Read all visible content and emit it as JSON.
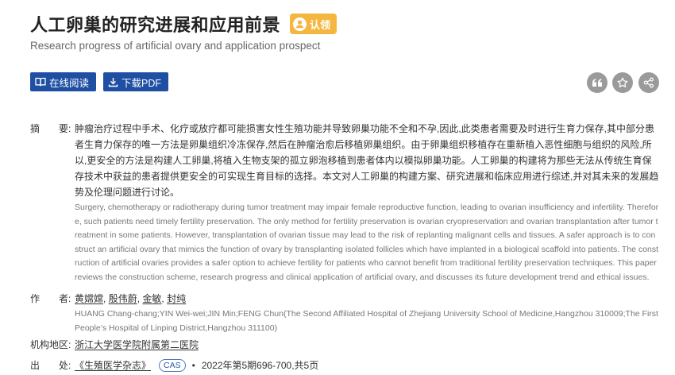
{
  "title": "人工卵巢的研究进展和应用前景",
  "claim_label": "认领",
  "subtitle": "Research progress of artificial ovary and application prospect",
  "buttons": {
    "read_online": "在线阅读",
    "download_pdf": "下载PDF"
  },
  "icons": {
    "cite": "quote-icon",
    "favorite": "star-icon",
    "share": "share-icon"
  },
  "abstract": {
    "label": "摘　　要:",
    "zh": "肿瘤治疗过程中手术、化疗或放疗都可能损害女性生殖功能并导致卵巢功能不全和不孕,因此,此类患者需要及时进行生育力保存,其中部分患者生育力保存的唯一方法是卵巢组织冷冻保存,然后在肿瘤治愈后移植卵巢组织。由于卵巢组织移植存在重新植入恶性细胞与组织的风险,所以,更安全的方法是构建人工卵巢,将植入生物支架的孤立卵泡移植到患者体内以模拟卵巢功能。人工卵巢的构建将为那些无法从传统生育保存技术中获益的患者提供更安全的可实现生育目标的选择。本文对人工卵巢的构建方案、研究进展和临床应用进行综述,并对其未来的发展趋势及伦理问题进行讨论。",
    "en": "Surgery, chemotherapy or radiotherapy during tumor treatment may impair female reproductive function, leading to ovarian insufficiency and infertility. Therefore, such patients need timely fertility preservation. The only method for fertility preservation is ovarian cryopreservation and ovarian transplantation after tumor treatment in some patients. However, transplantation of ovarian tissue may lead to the risk of replanting malignant cells and tissues. A safer approach is to construct an artificial ovary that mimics the function of ovary by transplanting isolated follicles which have implanted in a biological scaffold into patients. The construction of artificial ovaries provides a safer option to achieve fertility for patients who cannot benefit from traditional fertility preservation techniques. This paper reviews the construction scheme, research progress and clinical application of artificial ovary, and discusses its future development trend and ethical issues."
  },
  "authors": {
    "label": "作　　者:",
    "names": [
      "黄嫦嫦",
      "殷伟蔚",
      "金敏",
      "封纯"
    ],
    "separator": ",",
    "en": "HUANG Chang-chang;YIN Wei-wei;JIN Min;FENG Chun(The Second Affiliated Hospital of Zhejiang University School of Medicine,Hangzhou 310009;The First People’s Hospital of Linping District,Hangzhou 311100)"
  },
  "institution": {
    "label": "机构地区:",
    "name": "浙江大学医学院附属第二医院"
  },
  "source": {
    "label": "出　　处:",
    "journal": "《生殖医学杂志》",
    "badge": "CAS",
    "bullet": "•",
    "issue": "2022年第5期696-700,共5页"
  }
}
